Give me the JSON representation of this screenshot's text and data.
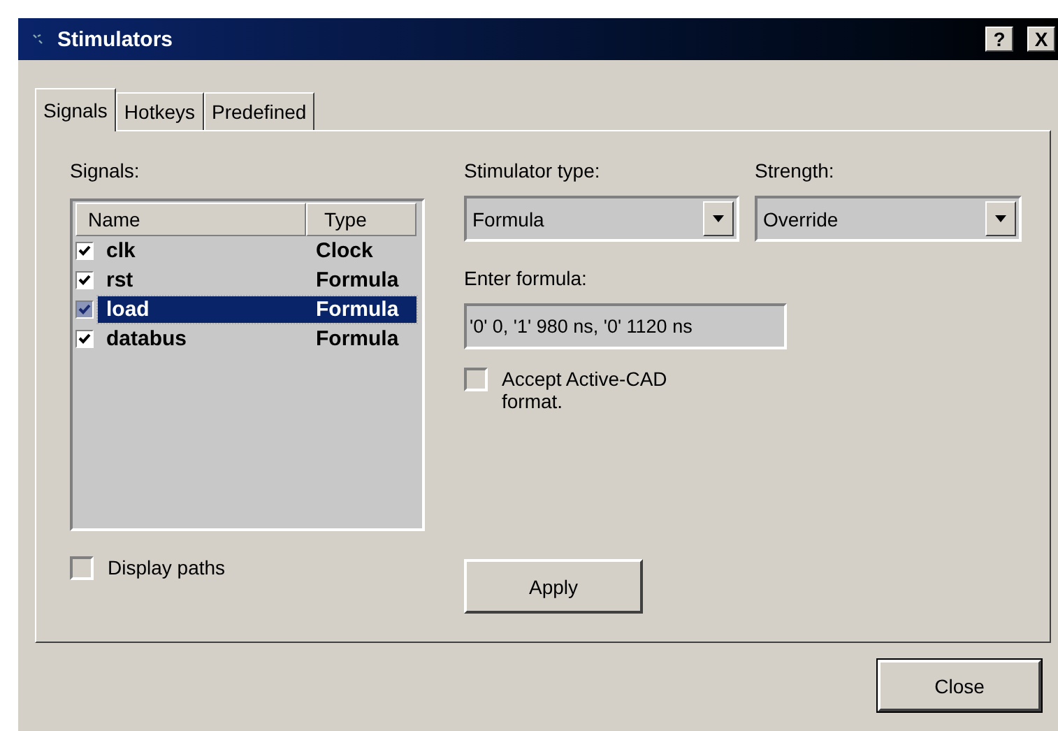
{
  "window": {
    "title": "Stimulators",
    "help_button": "?",
    "close_button": "X"
  },
  "tabs": [
    {
      "label": "Signals",
      "selected": true
    },
    {
      "label": "Hotkeys",
      "selected": false
    },
    {
      "label": "Predefined",
      "selected": false
    }
  ],
  "signals_label": "Signals:",
  "signal_list": {
    "columns": [
      "Name",
      "Type"
    ],
    "rows": [
      {
        "name": "clk",
        "type": "Clock",
        "checked": true,
        "selected": false
      },
      {
        "name": "rst",
        "type": "Formula",
        "checked": true,
        "selected": false
      },
      {
        "name": "load",
        "type": "Formula",
        "checked": true,
        "selected": true
      },
      {
        "name": "databus",
        "type": "Formula",
        "checked": true,
        "selected": false
      }
    ]
  },
  "display_paths": {
    "label": "Display paths",
    "checked": false
  },
  "stimulator_type": {
    "label": "Stimulator type:",
    "value": "Formula"
  },
  "strength": {
    "label": "Strength:",
    "value": "Override"
  },
  "formula": {
    "label": "Enter formula:",
    "value": "'0' 0, '1' 980 ns, '0' 1120 ns"
  },
  "accept_format": {
    "label": "Accept Active-CAD format.",
    "checked": false
  },
  "apply_button": "Apply",
  "close_button": "Close"
}
